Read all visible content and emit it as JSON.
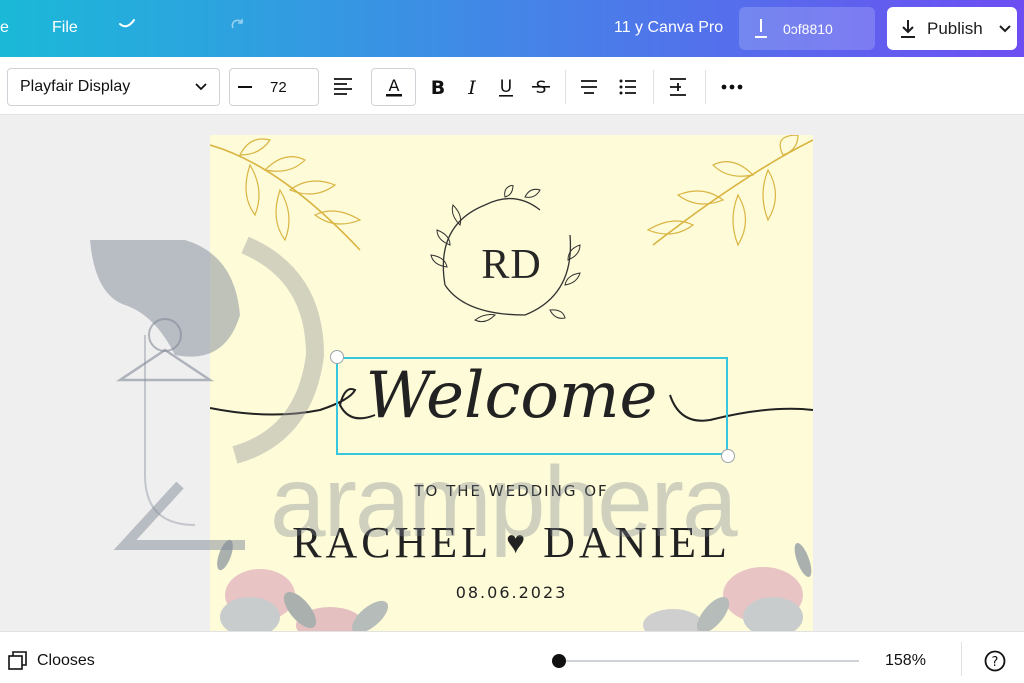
{
  "header": {
    "home_label": "e",
    "file_label": "File",
    "undo_icon": "undo-icon",
    "redo_icon": "redo-icon",
    "title": "11 y Canva Pro",
    "share_label": "0ɔf8810",
    "publish_label": "Publish"
  },
  "toolbar": {
    "font_name": "Playfair Display",
    "font_size": "72",
    "icons": [
      "text-align-icon",
      "text-color-icon",
      "bold-icon",
      "italic-icon",
      "underline-icon",
      "strikethrough-icon",
      "list-align-icon",
      "bullet-list-icon",
      "spacing-icon",
      "more-options-icon"
    ]
  },
  "design": {
    "monogram": "RD",
    "welcome": "Welcome",
    "tagline": "TO THE WEDDING OF",
    "name_left": "RACHEL",
    "heart": "♥",
    "name_right": "DANIEL",
    "date": "08.06.2023",
    "watermark": "aramphera"
  },
  "footer": {
    "pages_label": "Clooses",
    "zoom": "158%",
    "zoom_fraction": 0.0,
    "help_icon": "help-icon"
  },
  "colors": {
    "accent": "#36c6e0",
    "header_gradient_start": "#1bb9d8",
    "header_gradient_end": "#6d4ef2",
    "page_background": "#fdfbd8",
    "gold_leaf": "#d9b441"
  }
}
